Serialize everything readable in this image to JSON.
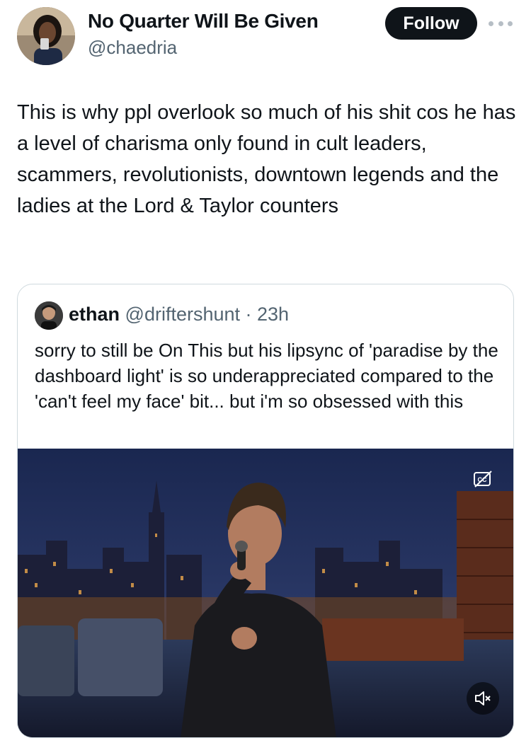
{
  "author": {
    "display_name": "No Quarter Will Be Given",
    "handle": "@chaedria",
    "avatar_icon": "user-avatar"
  },
  "actions": {
    "follow_label": "Follow",
    "more_icon": "more-horizontal-icon"
  },
  "tweet": {
    "text": "This is why ppl overlook so much of his shit cos he has a level of charisma only found in cult leaders, scammers, revolutionists, downtown legends and the ladies at the Lord & Taylor counters"
  },
  "quote": {
    "author_name": "ethan",
    "author_handle": "@driftershunt",
    "separator": " · ",
    "time": "23h",
    "text": "sorry to still be On This but his lipsync of 'paradise by the dashboard light' is so underappreciated compared to the 'can't feel my face' bit... but i'm so obsessed with this",
    "media": {
      "type": "video",
      "captions_icon": "closed-captions-off-icon",
      "mute_icon": "volume-muted-icon"
    }
  },
  "colors": {
    "text_primary": "#0f1419",
    "text_secondary": "#536471",
    "border": "#cfd9de",
    "follow_bg": "#0f1419"
  }
}
